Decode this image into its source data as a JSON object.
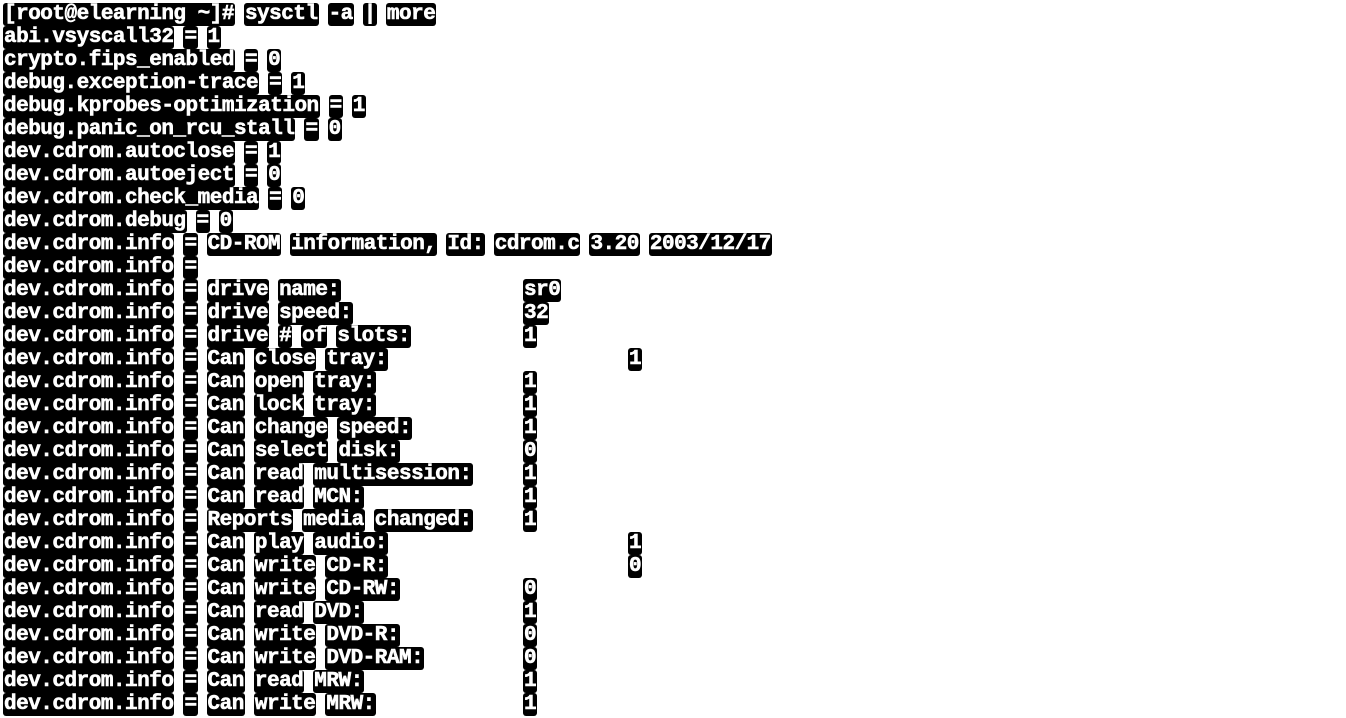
{
  "terminal": {
    "prompt": "[root@elearning ~]#",
    "command": [
      "sysctl",
      "-a",
      "|",
      "more"
    ],
    "lines": [
      {
        "key": "abi.vsyscall32",
        "value": "1"
      },
      {
        "key": "crypto.fips_enabled",
        "value": "0"
      },
      {
        "key": "debug.exception-trace",
        "value": "1"
      },
      {
        "key": "debug.kprobes-optimization",
        "value": "1"
      },
      {
        "key": "debug.panic_on_rcu_stall",
        "value": "0"
      },
      {
        "key": "dev.cdrom.autoclose",
        "value": "1"
      },
      {
        "key": "dev.cdrom.autoeject",
        "value": "0"
      },
      {
        "key": "dev.cdrom.check_media",
        "value": "0"
      },
      {
        "key": "dev.cdrom.debug",
        "value": "0"
      },
      {
        "key": "dev.cdrom.info",
        "value": "CD-ROM information, Id: cdrom.c 3.20 2003/12/17"
      },
      {
        "key": "dev.cdrom.info",
        "value": ""
      },
      {
        "key": "dev.cdrom.info",
        "label": "drive name:",
        "value": "sr0"
      },
      {
        "key": "dev.cdrom.info",
        "label": "drive speed:",
        "value": "32"
      },
      {
        "key": "dev.cdrom.info",
        "label": "drive # of slots:",
        "value": "1"
      },
      {
        "key": "dev.cdrom.info",
        "label": "Can close tray:",
        "value": "1",
        "far": true
      },
      {
        "key": "dev.cdrom.info",
        "label": "Can open tray:",
        "value": "1"
      },
      {
        "key": "dev.cdrom.info",
        "label": "Can lock tray:",
        "value": "1"
      },
      {
        "key": "dev.cdrom.info",
        "label": "Can change speed:",
        "value": "1"
      },
      {
        "key": "dev.cdrom.info",
        "label": "Can select disk:",
        "value": "0"
      },
      {
        "key": "dev.cdrom.info",
        "label": "Can read multisession:",
        "value": "1"
      },
      {
        "key": "dev.cdrom.info",
        "label": "Can read MCN:",
        "value": "1"
      },
      {
        "key": "dev.cdrom.info",
        "label": "Reports media changed:",
        "value": "1"
      },
      {
        "key": "dev.cdrom.info",
        "label": "Can play audio:",
        "value": "1",
        "far": true
      },
      {
        "key": "dev.cdrom.info",
        "label": "Can write CD-R:",
        "value": "0",
        "far": true
      },
      {
        "key": "dev.cdrom.info",
        "label": "Can write CD-RW:",
        "value": "0"
      },
      {
        "key": "dev.cdrom.info",
        "label": "Can read DVD:",
        "value": "1"
      },
      {
        "key": "dev.cdrom.info",
        "label": "Can write DVD-R:",
        "value": "0"
      },
      {
        "key": "dev.cdrom.info",
        "label": "Can write DVD-RAM:",
        "value": "0"
      },
      {
        "key": "dev.cdrom.info",
        "label": "Can read MRW:",
        "value": "1"
      },
      {
        "key": "dev.cdrom.info",
        "label": "Can write MRW:",
        "value": "1"
      }
    ]
  }
}
